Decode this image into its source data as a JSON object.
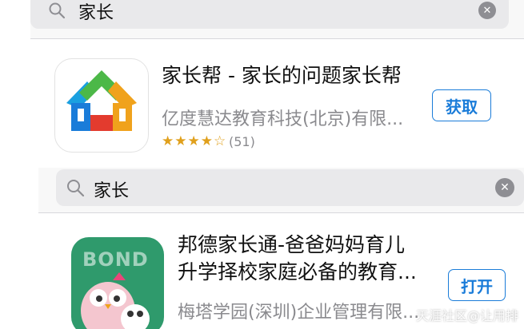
{
  "search1": {
    "query": "家长"
  },
  "result1": {
    "title": "家长帮 - 家长的问题家长帮",
    "developer": "亿度慧达教育科技(北京)有限...",
    "stars": "★★★★☆",
    "rating_count": "(51)",
    "button_label": "获取"
  },
  "search2": {
    "query": "家长"
  },
  "result2": {
    "title_line1": "邦德家长通-爸爸妈妈育儿",
    "title_line2": "升学择校家庭必备的教育...",
    "developer": "梅塔学园(深圳)企业管理有限...",
    "icon_text": "BOND",
    "button_label": "打开"
  },
  "watermark": "天涯社区@让用排",
  "colors": {
    "accent": "#1a7cd9",
    "bond_green": "#2f9a6c",
    "star": "#e0a01c"
  }
}
